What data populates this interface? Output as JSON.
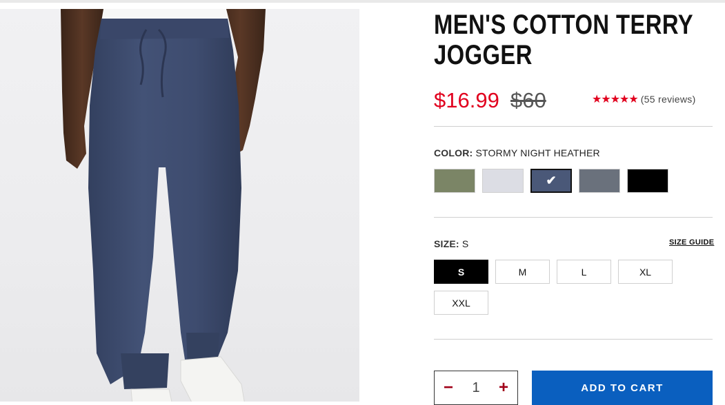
{
  "product": {
    "title": "MEN'S COTTON TERRY JOGGER",
    "sale_price": "$16.99",
    "original_price": "$60",
    "stars": "★★★★★",
    "reviews": "(55 reviews)"
  },
  "color": {
    "label": "COLOR:",
    "selected": "STORMY NIGHT HEATHER",
    "check_glyph": "✔",
    "swatches": [
      {
        "name": "olive",
        "hex": "#7b8566"
      },
      {
        "name": "light-gray",
        "hex": "#dcdde4"
      },
      {
        "name": "stormy-night-heather",
        "hex": "#4a5878",
        "selected": true
      },
      {
        "name": "slate-gray",
        "hex": "#6a717c"
      },
      {
        "name": "black",
        "hex": "#000000"
      }
    ]
  },
  "size": {
    "label": "SIZE:",
    "selected": "S",
    "guide": "SIZE GUIDE",
    "options": [
      "S",
      "M",
      "L",
      "XL",
      "XXL"
    ]
  },
  "cart": {
    "minus": "−",
    "quantity": "1",
    "plus": "+",
    "add_label": "ADD TO CART"
  },
  "colors": {
    "sale_red": "#e1001e",
    "cart_blue": "#0a5fbf",
    "pants_navy": "#3d4b6e"
  }
}
